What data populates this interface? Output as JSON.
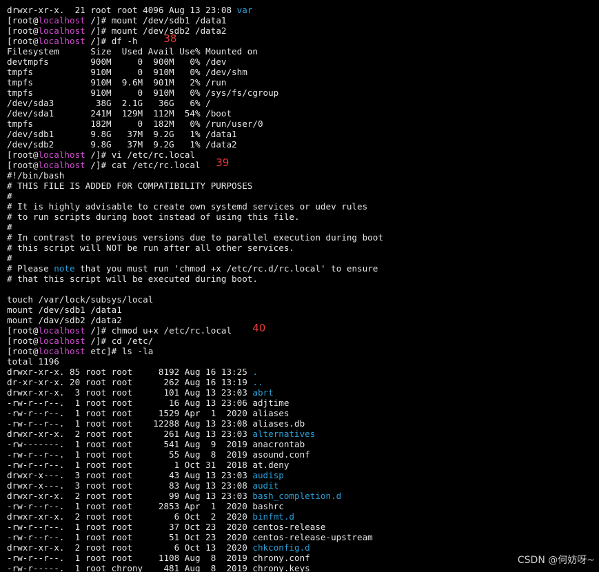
{
  "prompt": {
    "user": "[root@",
    "host": "localhost",
    "sep": " "
  },
  "lines": [
    {
      "type": "plain_dir",
      "pre": "drwxr-xr-x.  21 root root 4096 Aug 13 23:08 ",
      "dir": "var"
    },
    {
      "type": "prompt",
      "cwd": "/]# ",
      "cmd": "mount /dev/sdb1 /data1"
    },
    {
      "type": "prompt",
      "cwd": "/]# ",
      "cmd": "mount /dev/sdb2 /data2"
    },
    {
      "type": "prompt",
      "cwd": "/]# ",
      "cmd": "df -h",
      "ann": "38",
      "ann_col": 30
    },
    {
      "type": "plain",
      "text": "Filesystem      Size  Used Avail Use% Mounted on"
    },
    {
      "type": "plain",
      "text": "devtmpfs        900M     0  900M   0% /dev"
    },
    {
      "type": "plain",
      "text": "tmpfs           910M     0  910M   0% /dev/shm"
    },
    {
      "type": "plain",
      "text": "tmpfs           910M  9.6M  901M   2% /run"
    },
    {
      "type": "plain",
      "text": "tmpfs           910M     0  910M   0% /sys/fs/cgroup"
    },
    {
      "type": "plain",
      "text": "/dev/sda3        38G  2.1G   36G   6% /"
    },
    {
      "type": "plain",
      "text": "/dev/sda1       241M  129M  112M  54% /boot"
    },
    {
      "type": "plain",
      "text": "tmpfs           182M     0  182M   0% /run/user/0"
    },
    {
      "type": "plain",
      "text": "/dev/sdb1       9.8G   37M  9.2G   1% /data1"
    },
    {
      "type": "plain",
      "text": "/dev/sdb2       9.8G   37M  9.2G   1% /data2"
    },
    {
      "type": "prompt",
      "cwd": "/]# ",
      "cmd": "vi /etc/rc.local"
    },
    {
      "type": "prompt",
      "cwd": "/]# ",
      "cmd": "cat /etc/rc.local",
      "ann": "39",
      "ann_col": 40
    },
    {
      "type": "plain",
      "text": "#!/bin/bash"
    },
    {
      "type": "plain",
      "text": "# THIS FILE IS ADDED FOR COMPATIBILITY PURPOSES"
    },
    {
      "type": "plain",
      "text": "#"
    },
    {
      "type": "plain",
      "text": "# It is highly advisable to create own systemd services or udev rules"
    },
    {
      "type": "plain",
      "text": "# to run scripts during boot instead of using this file."
    },
    {
      "type": "plain",
      "text": "#"
    },
    {
      "type": "plain",
      "text": "# In contrast to previous versions due to parallel execution during boot"
    },
    {
      "type": "plain",
      "text": "# this script will NOT be run after all other services."
    },
    {
      "type": "plain",
      "text": "#"
    },
    {
      "type": "note",
      "pre": "# Please ",
      "note": "note",
      "post": " that you must run 'chmod +x /etc/rc.d/rc.local' to ensure"
    },
    {
      "type": "plain",
      "text": "# that this script will be executed during boot."
    },
    {
      "type": "plain",
      "text": ""
    },
    {
      "type": "plain",
      "text": "touch /var/lock/subsys/local"
    },
    {
      "type": "plain",
      "text": "mount /dev/sdb1 /data1"
    },
    {
      "type": "plain",
      "text": "mount /dav/sdb2 /data2"
    },
    {
      "type": "prompt",
      "cwd": "/]# ",
      "cmd": "chmod u+x /etc/rc.local",
      "ann": "40",
      "ann_col": 47
    },
    {
      "type": "prompt",
      "cwd": "/]# ",
      "cmd": "cd /etc/"
    },
    {
      "type": "prompt",
      "cwd": "etc]# ",
      "cmd": "ls -la"
    },
    {
      "type": "plain",
      "text": "total 1196"
    },
    {
      "type": "plain_dir",
      "pre": "drwxr-xr-x. 85 root root     8192 Aug 16 13:25 ",
      "dir": "."
    },
    {
      "type": "plain_dir",
      "pre": "dr-xr-xr-x. 20 root root      262 Aug 16 13:19 ",
      "dir": ".."
    },
    {
      "type": "plain_dir",
      "pre": "drwxr-xr-x.  3 root root      101 Aug 13 23:03 ",
      "dir": "abrt"
    },
    {
      "type": "plain",
      "text": "-rw-r--r--.  1 root root       16 Aug 13 23:06 adjtime"
    },
    {
      "type": "plain",
      "text": "-rw-r--r--.  1 root root     1529 Apr  1  2020 aliases"
    },
    {
      "type": "plain",
      "text": "-rw-r--r--.  1 root root    12288 Aug 13 23:08 aliases.db"
    },
    {
      "type": "plain_dir",
      "pre": "drwxr-xr-x.  2 root root      261 Aug 13 23:03 ",
      "dir": "alternatives"
    },
    {
      "type": "plain",
      "text": "-rw-------.  1 root root      541 Aug  9  2019 anacrontab"
    },
    {
      "type": "plain",
      "text": "-rw-r--r--.  1 root root       55 Aug  8  2019 asound.conf"
    },
    {
      "type": "plain",
      "text": "-rw-r--r--.  1 root root        1 Oct 31  2018 at.deny"
    },
    {
      "type": "plain_dir",
      "pre": "drwxr-x---.  3 root root       43 Aug 13 23:03 ",
      "dir": "audisp"
    },
    {
      "type": "plain_dir",
      "pre": "drwxr-x---.  3 root root       83 Aug 13 23:08 ",
      "dir": "audit"
    },
    {
      "type": "plain_dir",
      "pre": "drwxr-xr-x.  2 root root       99 Aug 13 23:03 ",
      "dir": "bash_completion.d"
    },
    {
      "type": "plain",
      "text": "-rw-r--r--.  1 root root     2853 Apr  1  2020 bashrc"
    },
    {
      "type": "plain_dir",
      "pre": "drwxr-xr-x.  2 root root        6 Oct  2  2020 ",
      "dir": "binfmt.d"
    },
    {
      "type": "plain",
      "text": "-rw-r--r--.  1 root root       37 Oct 23  2020 centos-release"
    },
    {
      "type": "plain",
      "text": "-rw-r--r--.  1 root root       51 Oct 23  2020 centos-release-upstream"
    },
    {
      "type": "plain_dir",
      "pre": "drwxr-xr-x.  2 root root        6 Oct 13  2020 ",
      "dir": "chkconfig.d"
    },
    {
      "type": "plain",
      "text": "-rw-r--r--.  1 root root     1108 Aug  8  2019 chrony.conf"
    },
    {
      "type": "plain",
      "text": "-rw-r-----.  1 root chrony    481 Aug  8  2019 chrony.keys"
    }
  ],
  "watermark": "CSDN @何妨呀~"
}
